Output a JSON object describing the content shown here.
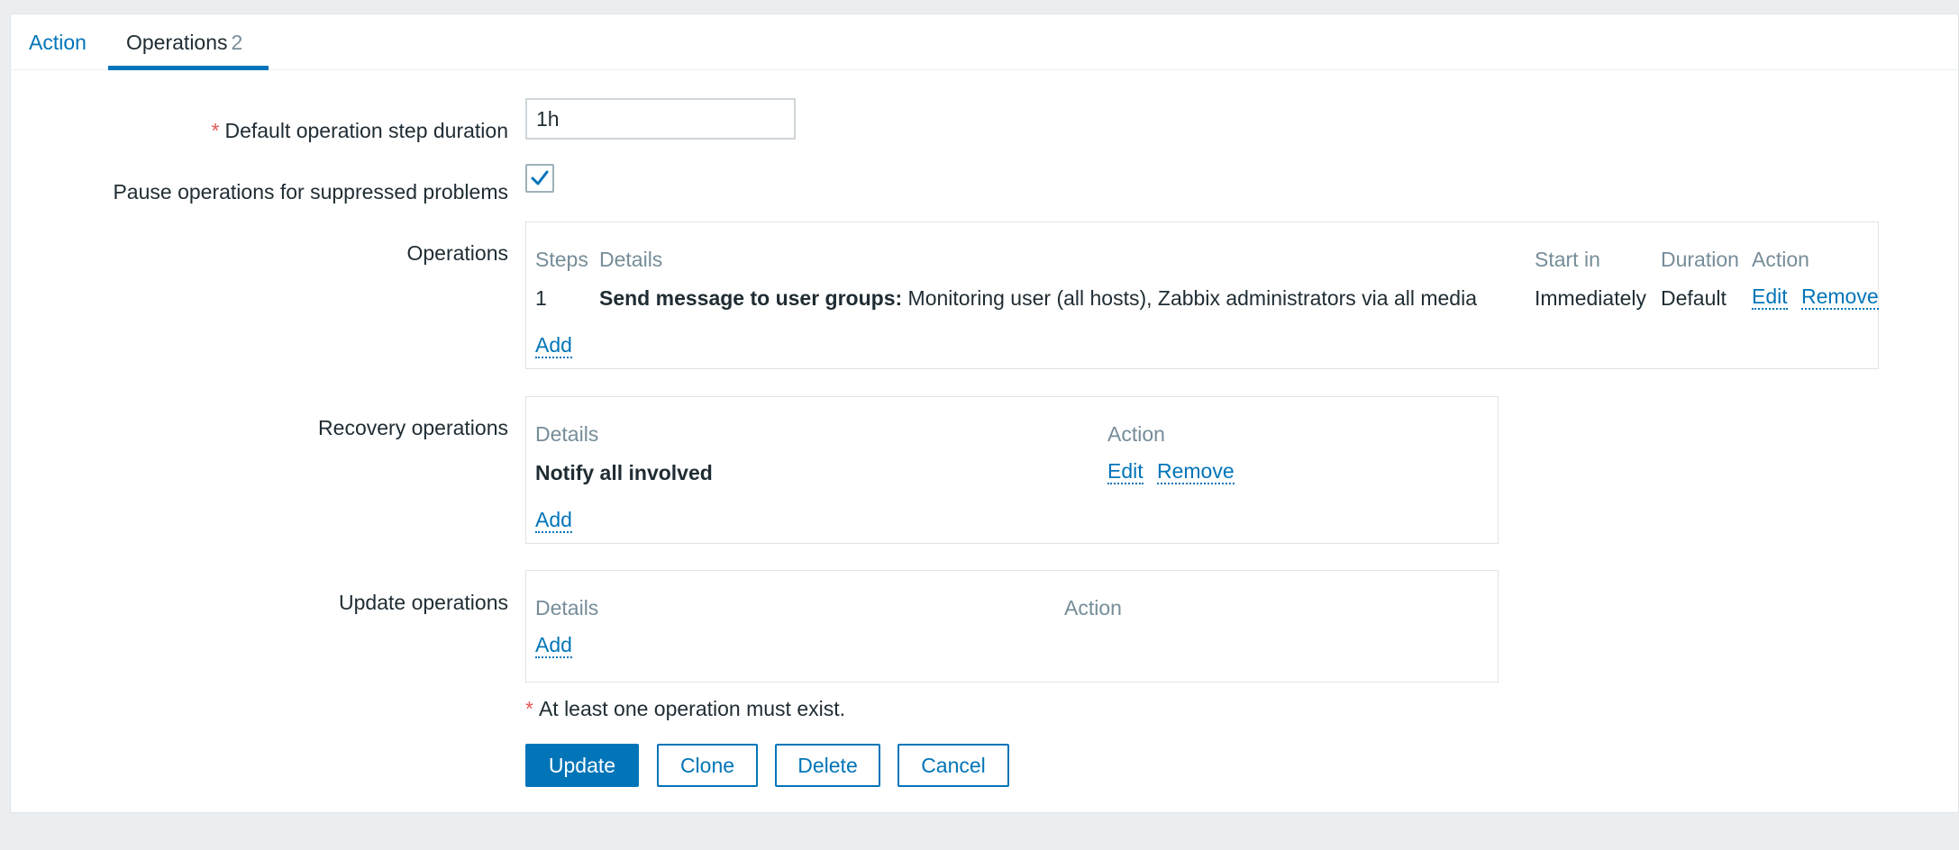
{
  "tabs": [
    {
      "label": "Action"
    },
    {
      "label": "Operations",
      "count": "2"
    }
  ],
  "form": {
    "step_duration": {
      "label": "Default operation step duration",
      "required_mark": "*",
      "value": "1h"
    },
    "pause": {
      "label": "Pause operations for suppressed problems",
      "checked": true
    },
    "operations": {
      "label": "Operations",
      "headers": {
        "steps": "Steps",
        "details": "Details",
        "start_in": "Start in",
        "duration": "Duration",
        "action": "Action"
      },
      "rows": [
        {
          "steps": "1",
          "details_bold": "Send message to user groups:",
          "details_rest": " Monitoring user (all hosts), Zabbix administrators via all media",
          "start_in": "Immediately",
          "duration": "Default",
          "edit": "Edit",
          "remove": "Remove"
        }
      ],
      "add": "Add"
    },
    "recovery": {
      "label": "Recovery operations",
      "headers": {
        "details": "Details",
        "action": "Action"
      },
      "rows": [
        {
          "details": "Notify all involved",
          "edit": "Edit",
          "remove": "Remove"
        }
      ],
      "add": "Add"
    },
    "update": {
      "label": "Update operations",
      "headers": {
        "details": "Details",
        "action": "Action"
      },
      "add": "Add"
    },
    "note": {
      "mark": "*",
      "text": "At least one operation must exist."
    }
  },
  "buttons": {
    "update": "Update",
    "clone": "Clone",
    "delete": "Delete",
    "cancel": "Cancel"
  },
  "colors": {
    "accent": "#0275b8",
    "required": "#e45959",
    "muted": "#768d99"
  }
}
